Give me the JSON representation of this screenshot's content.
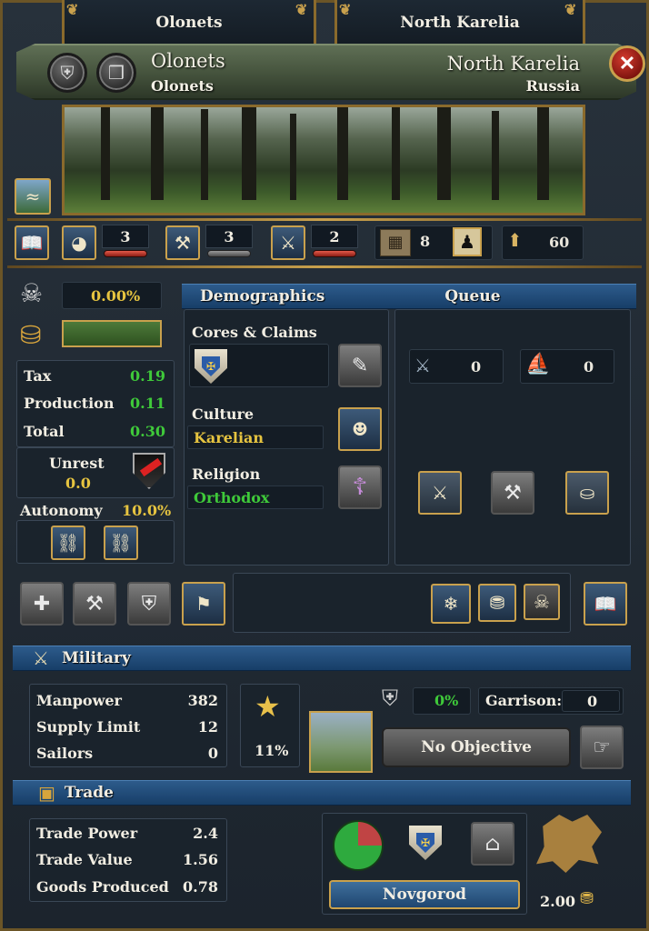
{
  "tabs": {
    "left": "Olonets",
    "right": "North Karelia"
  },
  "header": {
    "province_name": "Olonets",
    "capital_name": "Olonets",
    "area_name": "North Karelia",
    "owner_name": "Russia",
    "close_icon": "close-icon"
  },
  "devbar": {
    "tax_dev": "3",
    "production_dev": "3",
    "manpower_dev": "2",
    "trade_goods_count": "8",
    "development_total": "60"
  },
  "economy": {
    "devastation": "0.00%",
    "tax_label": "Tax",
    "tax_value": "0.19",
    "production_label": "Production",
    "production_value": "0.11",
    "total_label": "Total",
    "total_value": "0.30",
    "unrest_label": "Unrest",
    "unrest_value": "0.0",
    "autonomy_label": "Autonomy",
    "autonomy_value": "10.0%"
  },
  "demographics": {
    "title": "Demographics",
    "cores_label": "Cores & Claims",
    "culture_label": "Culture",
    "culture_value": "Karelian",
    "religion_label": "Religion",
    "religion_value": "Orthodox"
  },
  "queue": {
    "title": "Queue",
    "units_count": "0",
    "ships_count": "0"
  },
  "military": {
    "title": "Military",
    "manpower_label": "Manpower",
    "manpower_value": "382",
    "supply_label": "Supply Limit",
    "supply_value": "12",
    "sailors_label": "Sailors",
    "sailors_value": "0",
    "fort_percent": "11%",
    "siege_percent": "0%",
    "garrison_label": "Garrison:",
    "garrison_value": "0",
    "objective_label": "No Objective"
  },
  "trade": {
    "title": "Trade",
    "power_label": "Trade Power",
    "power_value": "2.4",
    "value_label": "Trade Value",
    "value_value": "1.56",
    "goods_label": "Goods Produced",
    "goods_value": "0.78",
    "node_name": "Novgorod",
    "goods_price": "2.00"
  },
  "colors": {
    "gold": "#c9a14d",
    "ribbon_blue": "#173e68",
    "banner_green": "#44523c",
    "green_text": "#3fc93a",
    "yellow_text": "#e6c440"
  }
}
